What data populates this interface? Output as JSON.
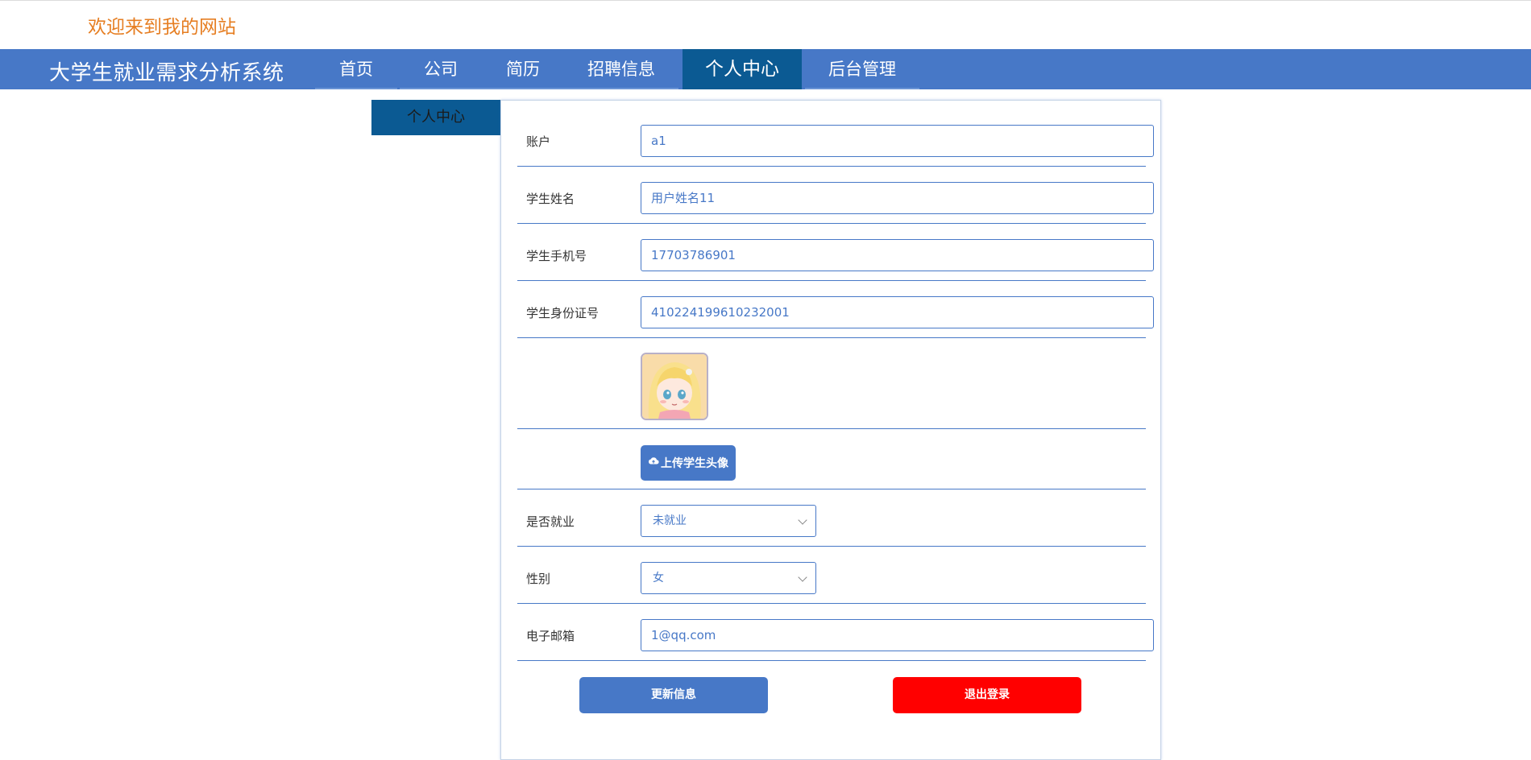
{
  "header": {
    "welcome": "欢迎来到我的网站"
  },
  "navbar": {
    "brand": "大学生就业需求分析系统",
    "items": [
      {
        "label": "首页"
      },
      {
        "label": "公司"
      },
      {
        "label": "简历"
      },
      {
        "label": "招聘信息"
      },
      {
        "label": "个人中心",
        "active": true
      },
      {
        "label": "后台管理"
      }
    ]
  },
  "sidebar": {
    "tab": "个人中心"
  },
  "form": {
    "account": {
      "label": "账户",
      "value": "a1"
    },
    "name": {
      "label": "学生姓名",
      "value": "用户姓名11"
    },
    "phone": {
      "label": "学生手机号",
      "value": "17703786901"
    },
    "id_card": {
      "label": "学生身份证号",
      "value": "410224199610232001"
    },
    "avatar": {
      "icon": "avatar-image"
    },
    "upload": {
      "label": "上传学生头像",
      "icon": "cloud-upload-icon"
    },
    "employed": {
      "label": "是否就业",
      "value": "未就业"
    },
    "gender": {
      "label": "性别",
      "value": "女"
    },
    "email": {
      "label": "电子邮箱",
      "value": "1@qq.com"
    }
  },
  "actions": {
    "update": "更新信息",
    "logout": "退出登录"
  },
  "colors": {
    "accent": "#4778c7",
    "active_nav": "#0b5a93",
    "welcome": "#e67e22",
    "danger": "#ff0000"
  }
}
